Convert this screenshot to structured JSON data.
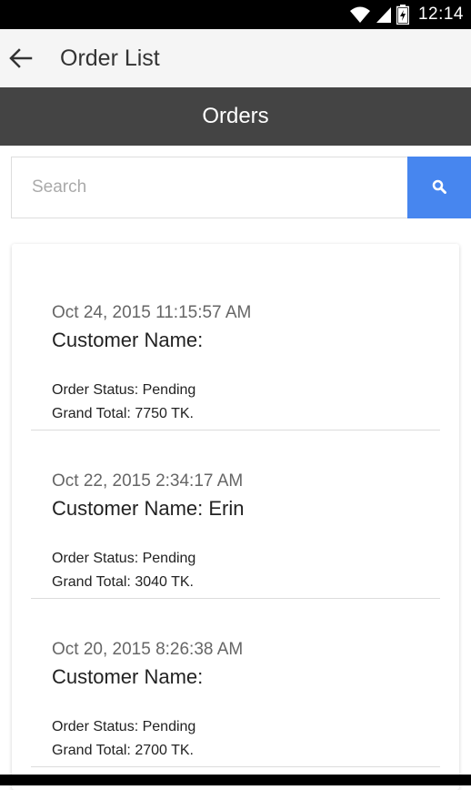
{
  "status_bar": {
    "time": "12:14",
    "icons": [
      "wifi-icon",
      "signal-icon",
      "battery-charging-icon"
    ]
  },
  "app_bar": {
    "back_icon": "arrow-left-icon",
    "title": "Order List"
  },
  "header": {
    "title": "Orders"
  },
  "search": {
    "placeholder": "Search",
    "value": "",
    "button_icon": "search-icon"
  },
  "orders": [
    {
      "date": "Oct 24, 2015 11:15:57 AM",
      "customer": "Customer Name:",
      "status": "Order Status: Pending",
      "total": "Grand Total: 7750 TK."
    },
    {
      "date": "Oct 22, 2015 2:34:17 AM",
      "customer": "Customer Name: Erin",
      "status": "Order Status: Pending",
      "total": "Grand Total: 3040 TK."
    },
    {
      "date": "Oct 20, 2015 8:26:38 AM",
      "customer": "Customer Name:",
      "status": "Order Status: Pending",
      "total": "Grand Total: 2700 TK."
    }
  ],
  "colors": {
    "status_bar": "#000000",
    "app_bar": "#f5f5f5",
    "header_band": "#444444",
    "search_button": "#4786ef"
  }
}
